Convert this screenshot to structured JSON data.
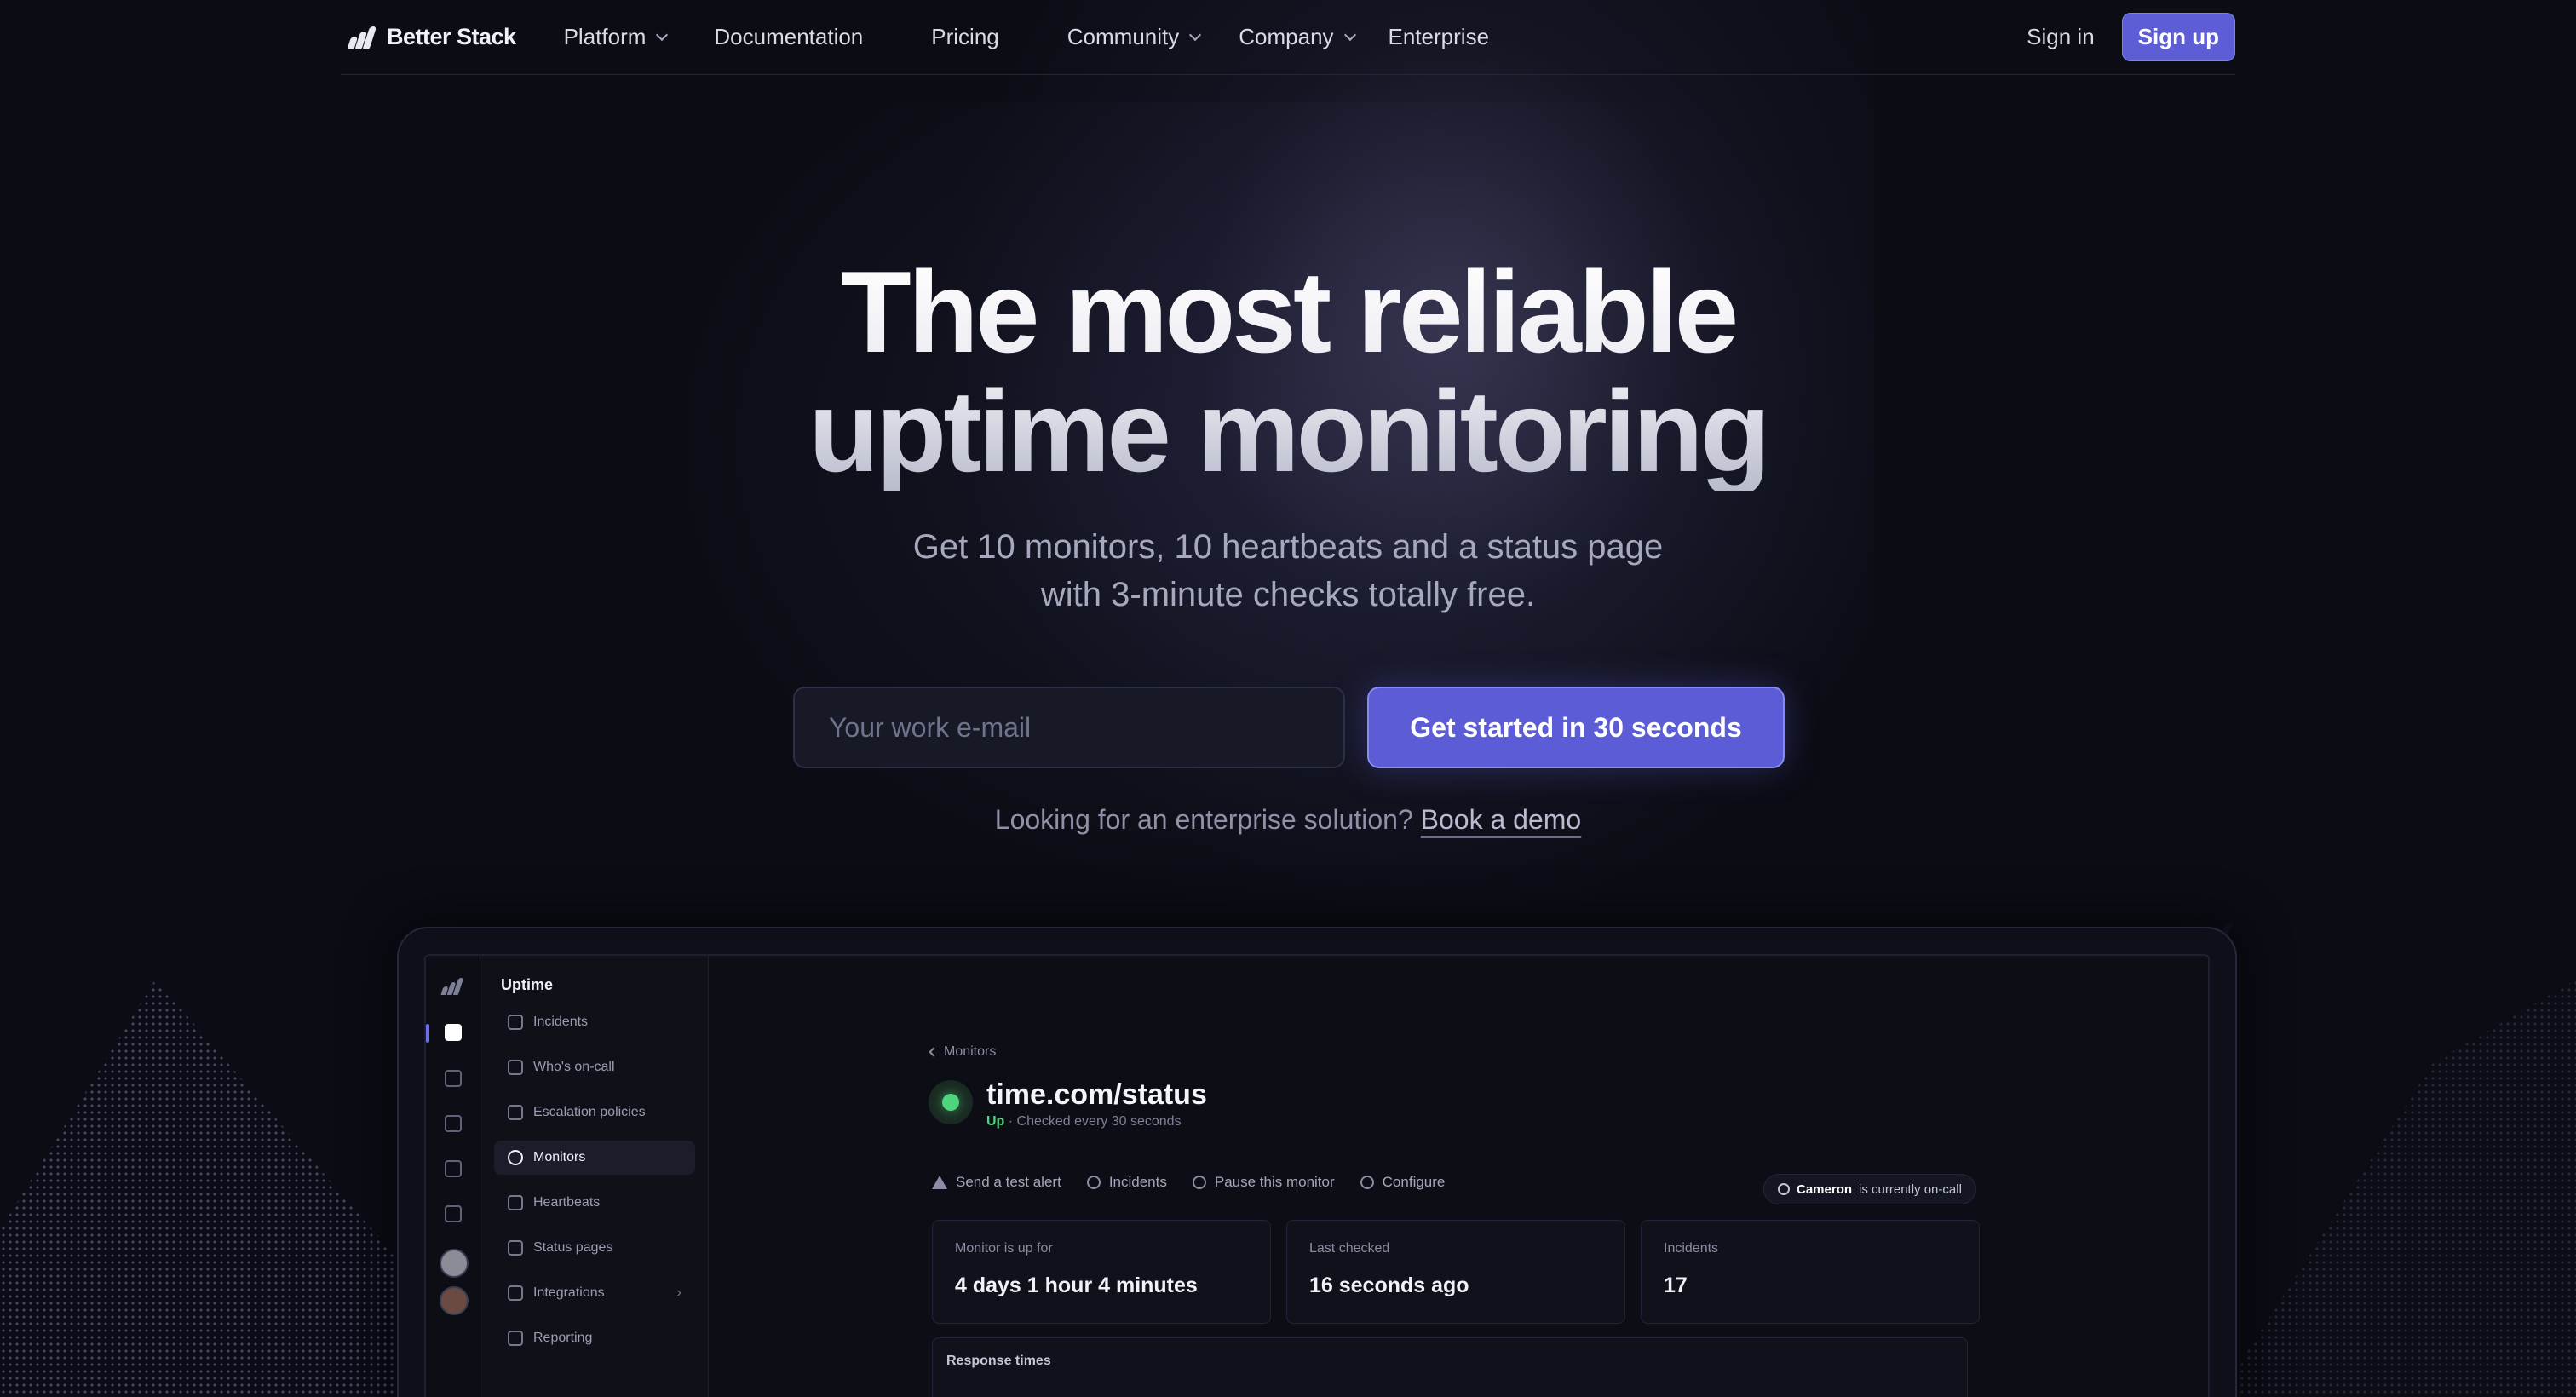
{
  "brand": {
    "name": "Better Stack"
  },
  "nav": {
    "items": [
      {
        "label": "Platform",
        "dropdown": true
      },
      {
        "label": "Documentation",
        "dropdown": false
      },
      {
        "label": "Pricing",
        "dropdown": false
      },
      {
        "label": "Community",
        "dropdown": true
      },
      {
        "label": "Company",
        "dropdown": true
      },
      {
        "label": "Enterprise",
        "dropdown": false
      }
    ],
    "signin_label": "Sign in",
    "signup_label": "Sign up"
  },
  "hero": {
    "title_line1": "The most reliable",
    "title_line2": "uptime monitoring",
    "subtitle_line1": "Get 10 monitors, 10 heartbeats and a status page",
    "subtitle_line2": "with 3-minute checks totally free.",
    "email_placeholder": "Your work e-mail",
    "cta_label": "Get started in 30 seconds",
    "enterprise_text": "Looking for an enterprise solution?",
    "enterprise_link": "Book a demo"
  },
  "app": {
    "sidebar_title": "Uptime",
    "sidebar_items": [
      {
        "label": "Incidents",
        "icon": "shield-icon"
      },
      {
        "label": "Who's on-call",
        "icon": "calendar-icon"
      },
      {
        "label": "Escalation policies",
        "icon": "list-icon"
      },
      {
        "label": "Monitors",
        "icon": "globe-icon",
        "active": true
      },
      {
        "label": "Heartbeats",
        "icon": "refresh-icon"
      },
      {
        "label": "Status pages",
        "icon": "broadcast-icon"
      },
      {
        "label": "Integrations",
        "icon": "grid-icon",
        "has_arrow": true
      },
      {
        "label": "Reporting",
        "icon": "chart-icon"
      }
    ],
    "breadcrumb": "Monitors",
    "monitor_name": "time.com/status",
    "status_text": "Up",
    "status_detail": "· Checked every 30 seconds",
    "status_color": "#4fd37d",
    "actions": [
      {
        "label": "Send a test alert",
        "icon": "warning-icon"
      },
      {
        "label": "Incidents",
        "icon": "shield-icon"
      },
      {
        "label": "Pause this monitor",
        "icon": "pause-icon"
      },
      {
        "label": "Configure",
        "icon": "gear-icon"
      }
    ],
    "oncall_name": "Cameron",
    "oncall_text": "is currently on-call",
    "cards": [
      {
        "label": "Monitor is up for",
        "value": "4 days 1 hour 4 minutes"
      },
      {
        "label": "Last checked",
        "value": "16 seconds ago"
      },
      {
        "label": "Incidents",
        "value": "17"
      }
    ],
    "response_title": "Response times"
  },
  "colors": {
    "accent": "#5b5cd6",
    "background": "#0b0c14"
  }
}
